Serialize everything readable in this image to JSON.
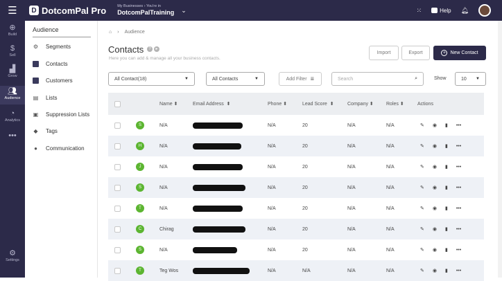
{
  "topbar": {
    "menu_icon": "hamburger-icon",
    "brand": "DotcomPal Pro",
    "business_small": "My Businesses › You're in",
    "business_name": "DotcomPalTraining",
    "help_label": "Help"
  },
  "leftnav": [
    {
      "label": "Build",
      "icon": "plus-circle-icon"
    },
    {
      "label": "Sell",
      "icon": "dollar-icon"
    },
    {
      "label": "Grow",
      "icon": "chart-icon"
    },
    {
      "label": "Audience",
      "icon": "users-icon",
      "active": true
    },
    {
      "label": "Analytics",
      "icon": "pie-icon"
    },
    {
      "label": "",
      "icon": "more-icon"
    },
    {
      "label": "Settings",
      "icon": "gear-icon"
    }
  ],
  "subnav": {
    "title": "Audience",
    "items": [
      {
        "label": "Segments"
      },
      {
        "label": "Contacts"
      },
      {
        "label": "Customers"
      },
      {
        "label": "Lists"
      },
      {
        "label": "Suppression Lists"
      },
      {
        "label": "Tags"
      },
      {
        "label": "Communication"
      }
    ]
  },
  "main": {
    "breadcrumb": "Audience",
    "title": "Contacts",
    "subtitle": "Here you can add & manage all your business contacts.",
    "import_label": "Import",
    "export_label": "Export",
    "new_contact_label": "New Contact",
    "filter1": "All Contact(18)",
    "filter2": "All Contacts",
    "add_filter": "Add Filter",
    "search_placeholder": "Search",
    "show_label": "Show",
    "show_value": "10"
  },
  "table": {
    "headers": [
      "Name",
      "Email Address",
      "Phone",
      "Lead Score",
      "Company",
      "Roles",
      "Actions"
    ],
    "rows": [
      {
        "initial": "S",
        "name": "N/A",
        "phone": "N/A",
        "lead": "20",
        "company": "N/A",
        "roles": "N/A"
      },
      {
        "initial": "H",
        "name": "N/A",
        "phone": "N/A",
        "lead": "20",
        "company": "N/A",
        "roles": "N/A"
      },
      {
        "initial": "J",
        "name": "N/A",
        "phone": "N/A",
        "lead": "20",
        "company": "N/A",
        "roles": "N/A"
      },
      {
        "initial": "S",
        "name": "N/A",
        "phone": "N/A",
        "lead": "20",
        "company": "N/A",
        "roles": "N/A"
      },
      {
        "initial": "T",
        "name": "N/A",
        "phone": "N/A",
        "lead": "20",
        "company": "N/A",
        "roles": "N/A"
      },
      {
        "initial": "C",
        "name": "Chirag",
        "phone": "N/A",
        "lead": "20",
        "company": "N/A",
        "roles": "N/A"
      },
      {
        "initial": "S",
        "name": "N/A",
        "phone": "N/A",
        "lead": "20",
        "company": "N/A",
        "roles": "N/A"
      },
      {
        "initial": "T",
        "name": "Teg Wos",
        "phone": "N/A",
        "lead": "N/A",
        "company": "N/A",
        "roles": "N/A"
      }
    ]
  },
  "colors": {
    "nav": "#2c2a49",
    "avatar_green": "#5cb531",
    "row_alt": "#eef1f6"
  }
}
